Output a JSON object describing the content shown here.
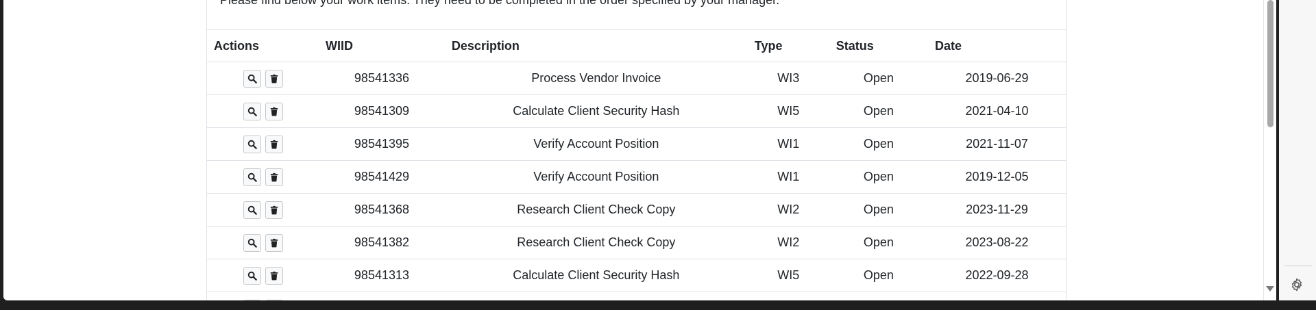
{
  "intro_text": "Please find below your work items. They need to be completed in the order specified by your manager.",
  "table": {
    "headers": {
      "actions": "Actions",
      "wiid": "WIID",
      "description": "Description",
      "type": "Type",
      "status": "Status",
      "date": "Date"
    },
    "rows": [
      {
        "wiid": "98541336",
        "description": "Process Vendor Invoice",
        "type": "WI3",
        "status": "Open",
        "date": "2019-06-29"
      },
      {
        "wiid": "98541309",
        "description": "Calculate Client Security Hash",
        "type": "WI5",
        "status": "Open",
        "date": "2021-04-10"
      },
      {
        "wiid": "98541395",
        "description": "Verify Account Position",
        "type": "WI1",
        "status": "Open",
        "date": "2021-11-07"
      },
      {
        "wiid": "98541429",
        "description": "Verify Account Position",
        "type": "WI1",
        "status": "Open",
        "date": "2019-12-05"
      },
      {
        "wiid": "98541368",
        "description": "Research Client Check Copy",
        "type": "WI2",
        "status": "Open",
        "date": "2023-11-29"
      },
      {
        "wiid": "98541382",
        "description": "Research Client Check Copy",
        "type": "WI2",
        "status": "Open",
        "date": "2023-08-22"
      },
      {
        "wiid": "98541313",
        "description": "Calculate Client Security Hash",
        "type": "WI5",
        "status": "Open",
        "date": "2022-09-28"
      },
      {
        "wiid": "",
        "description": "",
        "type": "",
        "status": "",
        "date": ""
      }
    ]
  },
  "icons": {
    "view": "search-icon",
    "delete": "trash-icon",
    "sidebar": "gear-icon"
  },
  "colors": {
    "border": "#dee2e6",
    "text": "#212529",
    "button_bg": "#f8f9fa"
  }
}
